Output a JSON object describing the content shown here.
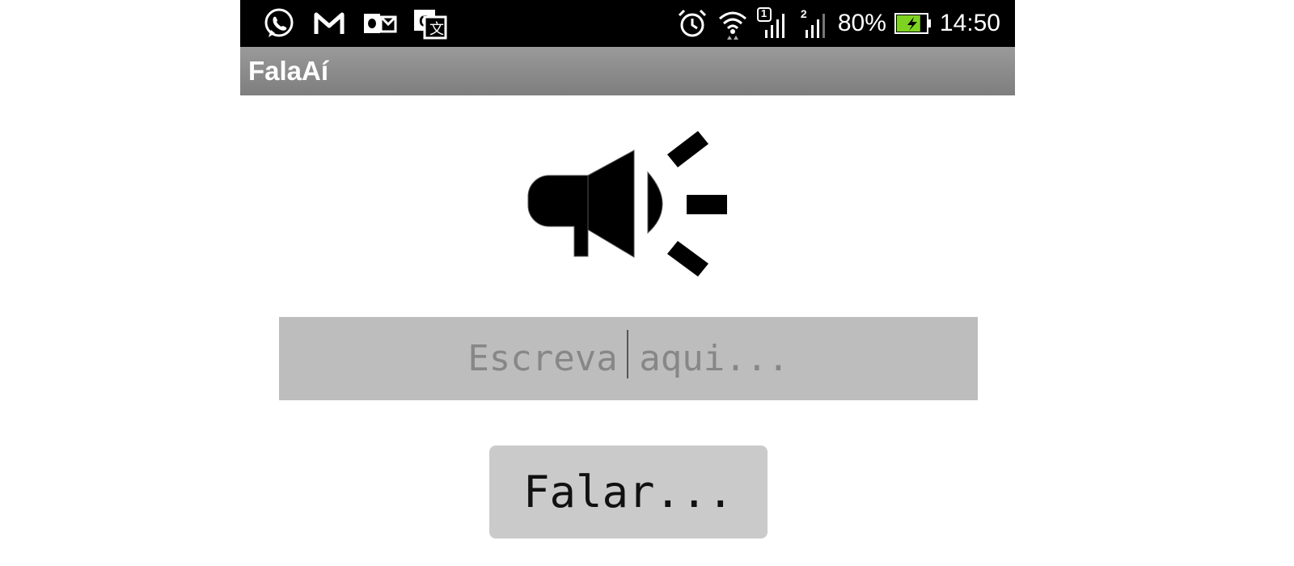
{
  "status_bar": {
    "notification_icons": [
      "whatsapp-icon",
      "gmail-icon",
      "outlook-icon",
      "google-translate-icon"
    ],
    "system_icons": [
      "alarm-icon",
      "wifi-icon",
      "signal-sim1-icon",
      "signal-sim2-icon"
    ],
    "sim1_label": "1",
    "sim2_label": "2",
    "battery_percent": "80%",
    "battery_level": 0.8,
    "battery_icon": "battery-charging-icon",
    "time": "14:50",
    "colors": {
      "background": "#000000",
      "text": "#ffffff",
      "battery_fill": "#7ed321"
    }
  },
  "action_bar": {
    "title": "FalaAí",
    "colors": {
      "background_top": "#9a9a9a",
      "background_bottom": "#7e7e7e"
    }
  },
  "main": {
    "megaphone_icon": "megaphone-icon",
    "input": {
      "placeholder": "Escreva aqui...",
      "value": ""
    },
    "speak_button": {
      "label": "Falar..."
    },
    "colors": {
      "input_bg": "#bdbdbd",
      "button_bg": "#cacaca"
    }
  }
}
